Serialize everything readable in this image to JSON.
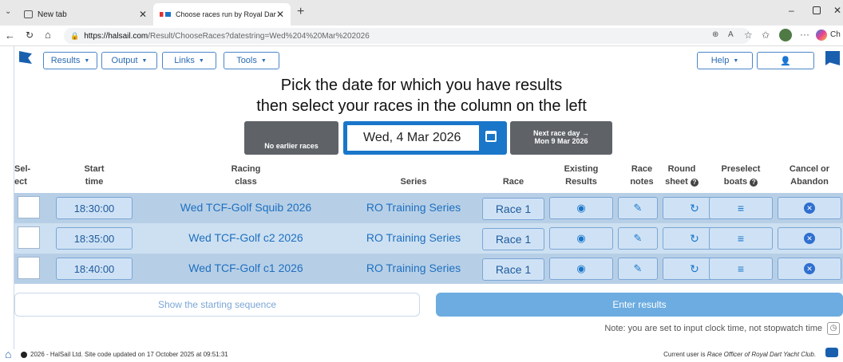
{
  "browser": {
    "tabs": [
      {
        "label": "New tab"
      },
      {
        "label": "Choose races run by Royal Dart Ya"
      }
    ],
    "url_host": "https://halsail.com",
    "url_path": "/Result/ChooseRaces?datestring=Wed%204%20Mar%202026",
    "profile_label": "Ch"
  },
  "nav": {
    "results": "Results",
    "output": "Output",
    "links": "Links",
    "tools": "Tools",
    "help": "Help"
  },
  "page": {
    "title_line1": "Pick the date for which you have results",
    "title_line2": "then select your races in the column on the left"
  },
  "date_picker": {
    "prev_label": "No earlier races",
    "current_date": "Wed, 4 Mar 2026",
    "next_label_line1": "Next race day →",
    "next_label_line2": "Mon 9 Mar 2026"
  },
  "table": {
    "headers": {
      "select_1": "Sel-",
      "select_2": "ect",
      "start_1": "Start",
      "start_2": "time",
      "class_1": "Racing",
      "class_2": "class",
      "series": "Series",
      "race": "Race",
      "existing_1": "Existing",
      "existing_2": "Results",
      "notes_1": "Race",
      "notes_2": "notes",
      "round_1": "Round",
      "round_2": "sheet",
      "preselect_1": "Preselect",
      "preselect_2": "boats",
      "cancel_1": "Cancel or",
      "cancel_2": "Abandon"
    },
    "rows": [
      {
        "time": "18:30:00",
        "class": "Wed TCF-Golf Squib 2026",
        "series": "RO Training Series",
        "race": "Race 1"
      },
      {
        "time": "18:35:00",
        "class": "Wed TCF-Golf c2 2026",
        "series": "RO Training Series",
        "race": "Race 1"
      },
      {
        "time": "18:40:00",
        "class": "Wed TCF-Golf c1 2026",
        "series": "RO Training Series",
        "race": "Race 1"
      }
    ]
  },
  "actions": {
    "show_sequence": "Show the starting sequence",
    "enter_results": "Enter results"
  },
  "note": "Note: you are set to input clock time, not stopwatch time",
  "footer": {
    "copyright": "2026 - HalSail Ltd. Site code updated on 17 October 2025 at 09:51:31",
    "user_prefix": "Current user is ",
    "user_role": "Race Officer of Royal Dart Yacht Club",
    "user_suffix": "."
  },
  "colors": {
    "accent": "#1a76c9",
    "row_dark": "#b7cfe6",
    "row_light": "#cde0f1",
    "cancel": "#2f6fd0"
  }
}
